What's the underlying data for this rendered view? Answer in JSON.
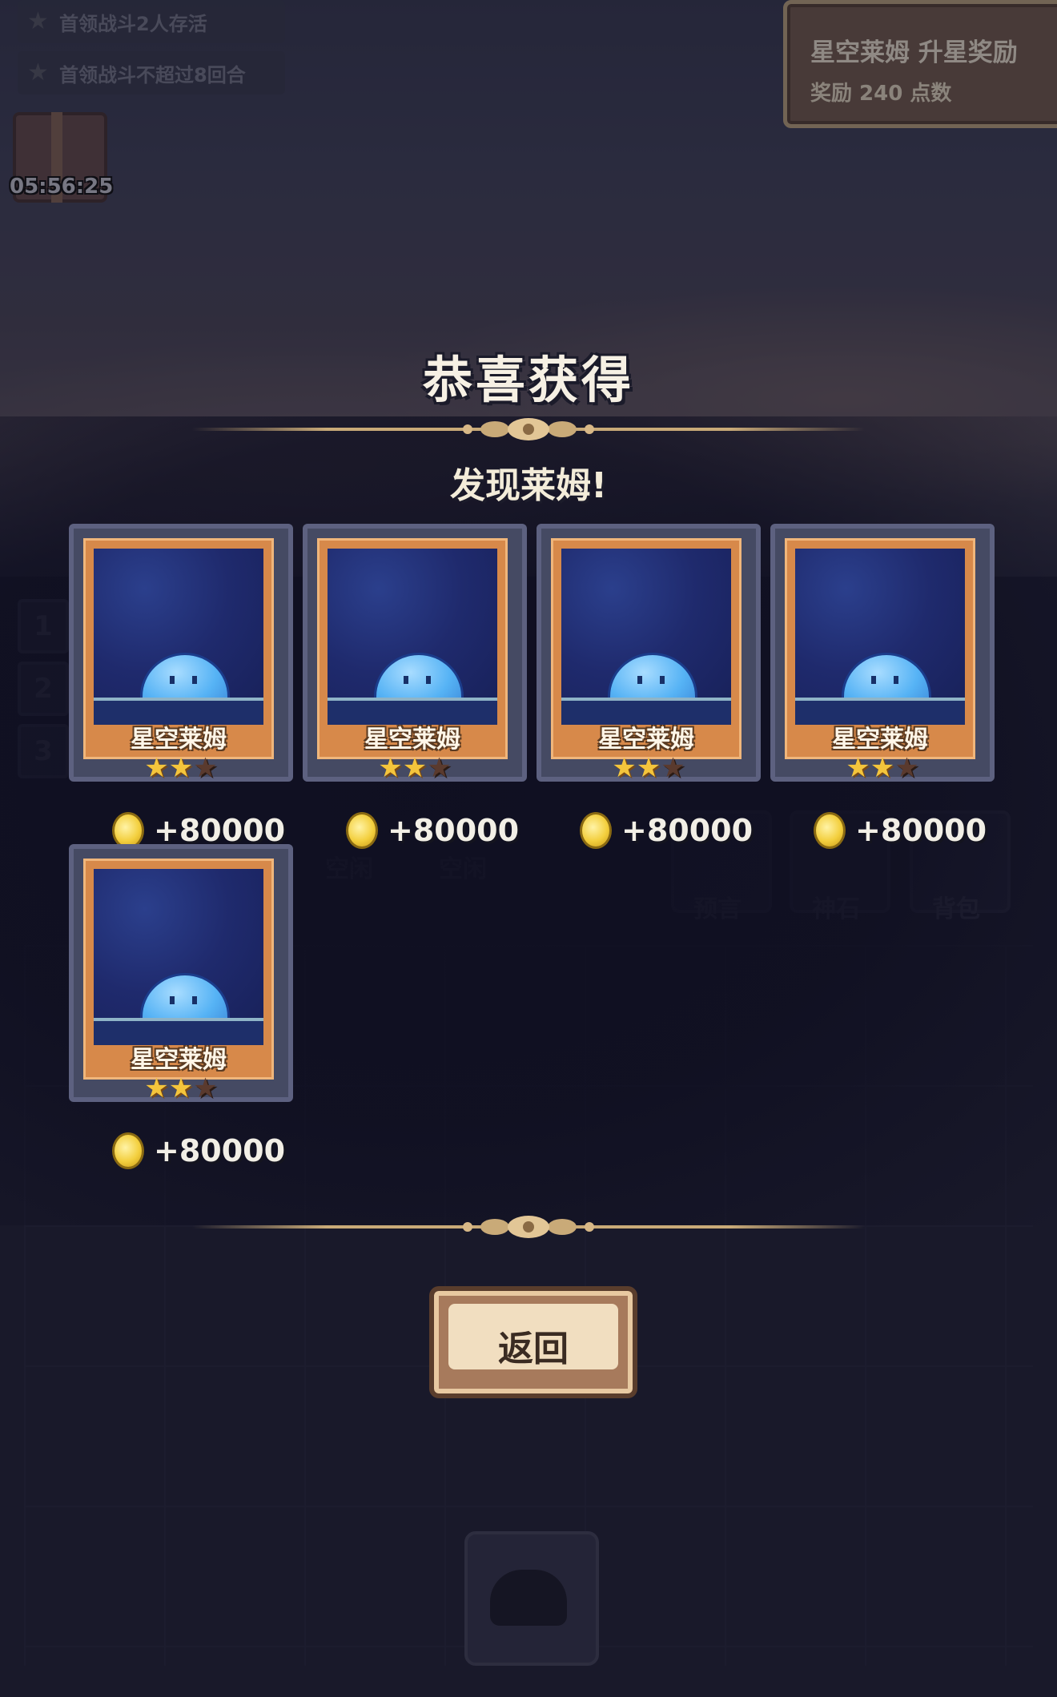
{
  "quests": [
    {
      "label": "首领战斗2人存活"
    },
    {
      "label": "首领战斗不超过8回合"
    }
  ],
  "gift": {
    "timer": "05:56:25"
  },
  "reward_panel": {
    "title": "星空莱姆 升星奖励",
    "subtitle": "奖励 240 点数"
  },
  "side_tabs": [
    "1",
    "2",
    "3"
  ],
  "bottom_bar": {
    "slots": [
      "空闲",
      "空闲"
    ],
    "buttons": [
      "预言",
      "神石",
      "背包"
    ]
  },
  "modal": {
    "title": "恭喜获得",
    "subtitle": "发现莱姆!",
    "back_label": "返回",
    "cards": [
      {
        "name": "星空莱姆",
        "stars_filled": 2,
        "stars_total": 3,
        "coins": "+80000"
      },
      {
        "name": "星空莱姆",
        "stars_filled": 2,
        "stars_total": 3,
        "coins": "+80000"
      },
      {
        "name": "星空莱姆",
        "stars_filled": 2,
        "stars_total": 3,
        "coins": "+80000"
      },
      {
        "name": "星空莱姆",
        "stars_filled": 2,
        "stars_total": 3,
        "coins": "+80000"
      },
      {
        "name": "星空莱姆",
        "stars_filled": 2,
        "stars_total": 3,
        "coins": "+80000"
      }
    ]
  },
  "colors": {
    "gold": "#f4c53c",
    "card_frame": "#d7894a",
    "card_sky": "#1f2a6d"
  }
}
